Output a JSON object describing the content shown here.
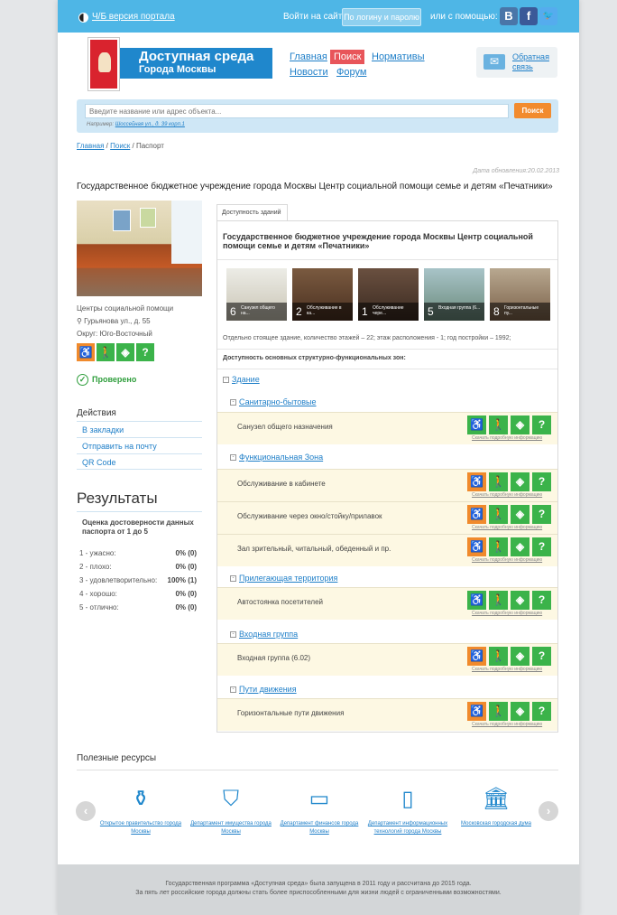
{
  "topbar": {
    "bw_link": "Ч/Б версия портала",
    "login_text": "Войти на сайт",
    "login_button": "По логину и паролю",
    "or_text": "или с помощью:",
    "social": [
      "В",
      "f",
      "t"
    ]
  },
  "header": {
    "logo_line1": "Доступная среда",
    "logo_line2": "Города Москвы",
    "nav": {
      "home": "Главная",
      "search": "Поиск",
      "norms": "Нормативы",
      "news": "Новости",
      "forum": "Форум"
    },
    "feedback": "Обратная связь"
  },
  "search": {
    "placeholder": "Введите название или адрес объекта...",
    "button": "Поиск",
    "example_label": "Например:",
    "example_link": "Шоссейная ул., д. 39 корп.1"
  },
  "breadcrumb": {
    "home": "Главная",
    "sep1": " / ",
    "search": "Поиск",
    "sep2": " / ",
    "current": "Паспорт"
  },
  "updated": "Дата обновления:20.02.2013",
  "page_title": "Государственное бюджетное учреждение города Москвы Центр социальной помощи семье и детям «Печатники»",
  "org": {
    "type": "Центры социальной помощи",
    "address": "Гурьянова ул., д. 55",
    "district": "Округ: Юго-Восточный",
    "verified": "Проверено"
  },
  "actions": {
    "heading": "Действия",
    "items": [
      "В закладки",
      "Отправить на почту",
      "QR Code"
    ]
  },
  "results": {
    "heading": "Результаты",
    "rating_heading": "Оценка достоверности данных паспорта от 1 до 5",
    "ratings": [
      {
        "label": "1 - ужасно:",
        "value": "0% (0)"
      },
      {
        "label": "2 - плохо:",
        "value": "0% (0)"
      },
      {
        "label": "3 - удовлетворительно:",
        "value": "100% (1)"
      },
      {
        "label": "4 - хорошо:",
        "value": "0% (0)"
      },
      {
        "label": "5 - отлично:",
        "value": "0% (0)"
      }
    ]
  },
  "panel": {
    "tab": "Доступность зданий",
    "title": "Государственное бюджетное учреждение города Москвы Центр социальной помощи семье и детям «Печатники»",
    "thumbs": [
      {
        "n": "6",
        "caption": "Санузел общего на..."
      },
      {
        "n": "2",
        "caption": "Обслуживание в ка..."
      },
      {
        "n": "1",
        "caption": "Обслуживание чере..."
      },
      {
        "n": "5",
        "caption": "Входная группа (6..."
      },
      {
        "n": "8",
        "caption": "Горизонтальные пу..."
      }
    ],
    "info": "Отдельно стоящее здание, количество этажей – 22; этаж расположения - 1; год постройки – 1992;",
    "avail_heading": "Доступность основных структурно-функциональных зон:",
    "building": "Здание",
    "download_label": "Скачать подробную информацию",
    "sections": [
      {
        "name": "Санитарно-бытовые",
        "rows": [
          {
            "label": "Санузел общего назначения",
            "status": "gggg"
          }
        ]
      },
      {
        "name": "Функциональная Зона",
        "rows": [
          {
            "label": "Обслуживание в кабинете",
            "status": "oggg"
          },
          {
            "label": "Обслуживание через окно/стойку/прилавок",
            "status": "oggg"
          },
          {
            "label": "Зал зрительный, читальный, обеденный и пр.",
            "status": "oggg"
          }
        ]
      },
      {
        "name": "Прилегающая территория",
        "rows": [
          {
            "label": "Автостоянка посетителей",
            "status": "gggg"
          }
        ]
      },
      {
        "name": "Входная группа",
        "rows": [
          {
            "label": "Входная группа (6.02)",
            "status": "oggg"
          }
        ]
      },
      {
        "name": "Пути движения",
        "rows": [
          {
            "label": "Горизонтальные пути движения",
            "status": "oggg"
          }
        ]
      }
    ]
  },
  "accessibility_colors": {
    "ok": "#3bb34a",
    "partial": "#f08a2c"
  },
  "resources": {
    "heading": "Полезные ресурсы",
    "items": [
      {
        "label": "Открытое правительство города Москвы",
        "icon": "government-icon"
      },
      {
        "label": "Департамент имущества города Москвы",
        "icon": "shield-icon"
      },
      {
        "label": "Департамент финансов города Москвы",
        "icon": "briefcase-icon"
      },
      {
        "label": "Департамент информационных технологий города Москвы",
        "icon": "monitor-icon"
      },
      {
        "label": "Московская городская дума",
        "icon": "building-icon"
      }
    ]
  },
  "footer": {
    "line1": "Государственная программа «Доступная среда» была запущена в 2011 году и рассчитана до 2015 года.",
    "line2": "За пять лет российские города должны стать более приспособленными для жизни людей с ограниченными возможностями."
  }
}
